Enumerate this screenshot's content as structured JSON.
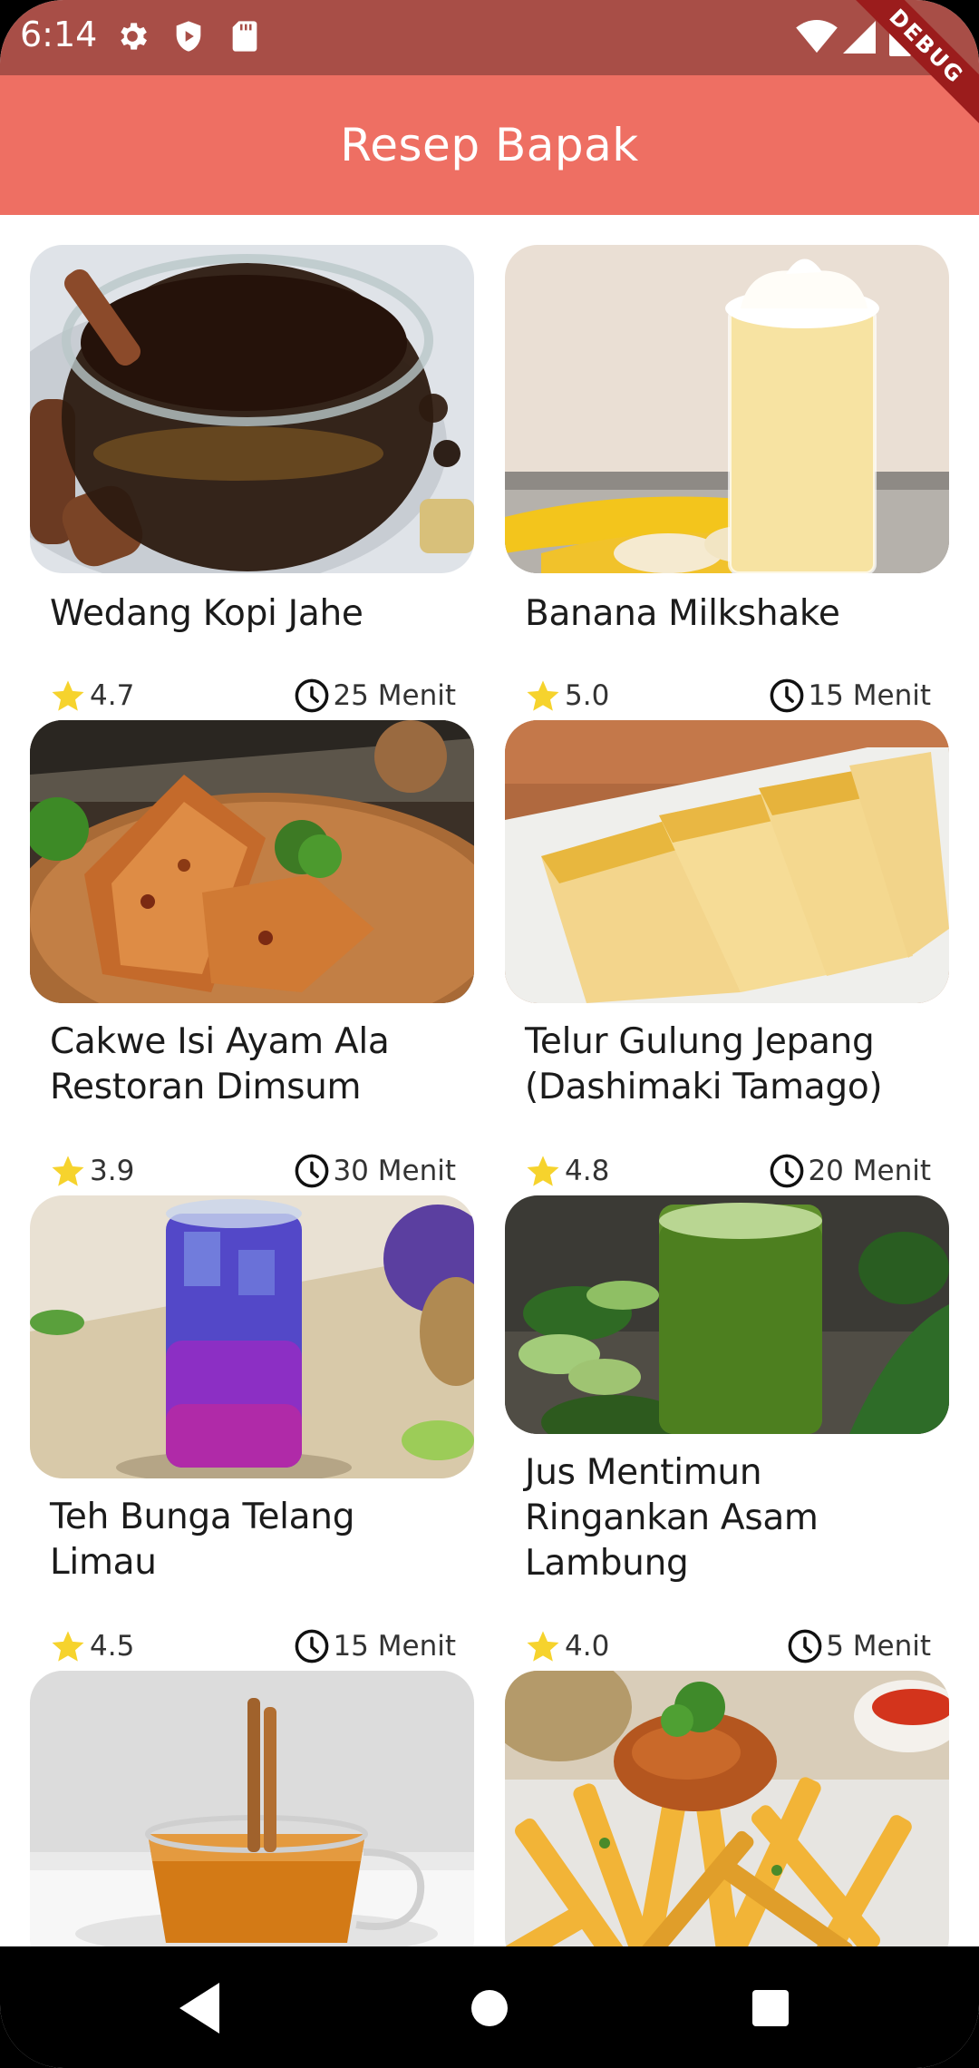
{
  "status_bar": {
    "time": "6:14",
    "icons": [
      "gear-icon",
      "shield-icon",
      "sd-card-icon",
      "wifi-icon",
      "signal-icon",
      "battery-icon"
    ]
  },
  "app_bar": {
    "title": "Resep Bapak",
    "debug_banner": "DEBUG"
  },
  "colors": {
    "status_bar": "#a84e47",
    "app_bar": "#ee6f63",
    "star": "#f6d32d",
    "text": "#1b1b1b"
  },
  "recipes": [
    {
      "title": "Wedang Kopi Jahe",
      "rating": "4.7",
      "duration": "25 Menit",
      "image": "ginger-coffee"
    },
    {
      "title": "Banana Milkshake",
      "rating": "5.0",
      "duration": "15 Menit",
      "image": "banana-milkshake"
    },
    {
      "title": " Cakwe Isi Ayam Ala\nRestoran Dimsum",
      "rating": "3.9",
      "duration": "30 Menit",
      "image": "cakwe"
    },
    {
      "title": " Telur Gulung Jepang\n(Dashimaki Tamago)",
      "rating": "4.8",
      "duration": "20 Menit",
      "image": "tamago"
    },
    {
      "title": "Teh Bunga Telang\nLimau",
      "rating": "4.5",
      "duration": "15 Menit",
      "image": "butterfly-pea-tea"
    },
    {
      "title": "Jus Mentimun\nRingankan Asam\nLambung",
      "rating": "4.0",
      "duration": "5 Menit",
      "image": "cucumber-juice"
    },
    {
      "title": "",
      "rating": "",
      "duration": "",
      "image": "cinnamon-tea"
    },
    {
      "title": "",
      "rating": "",
      "duration": "",
      "image": "french-fries"
    }
  ],
  "nav_bar": {
    "buttons": [
      "back-icon",
      "home-icon",
      "recents-icon"
    ]
  }
}
